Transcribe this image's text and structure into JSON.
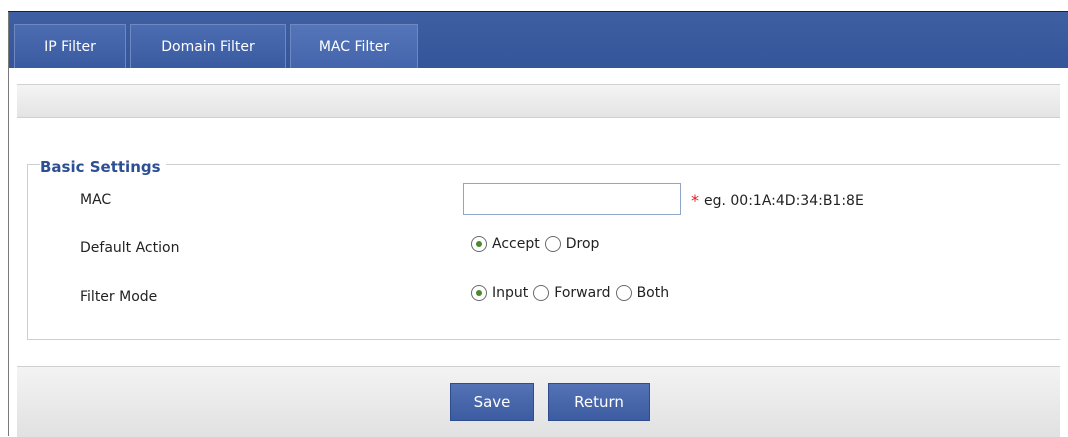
{
  "tabs": [
    {
      "label": "IP Filter"
    },
    {
      "label": "Domain Filter"
    },
    {
      "label": "MAC Filter"
    }
  ],
  "active_tab": "MAC Filter",
  "section": {
    "legend": "Basic Settings"
  },
  "mac": {
    "label": "MAC",
    "value": "",
    "required_mark": "*",
    "hint": "eg. 00:1A:4D:34:B1:8E"
  },
  "default_action": {
    "label": "Default Action",
    "options": [
      "Accept",
      "Drop"
    ],
    "selected": "Accept"
  },
  "filter_mode": {
    "label": "Filter Mode",
    "options": [
      "Input",
      "Forward",
      "Both"
    ],
    "selected": "Input"
  },
  "buttons": {
    "save": "Save",
    "return": "Return"
  },
  "colors": {
    "tab_bar": "#3f5fa3",
    "legend": "#2c4f94",
    "required": "#e01b1b",
    "button": "#4a69ad"
  }
}
